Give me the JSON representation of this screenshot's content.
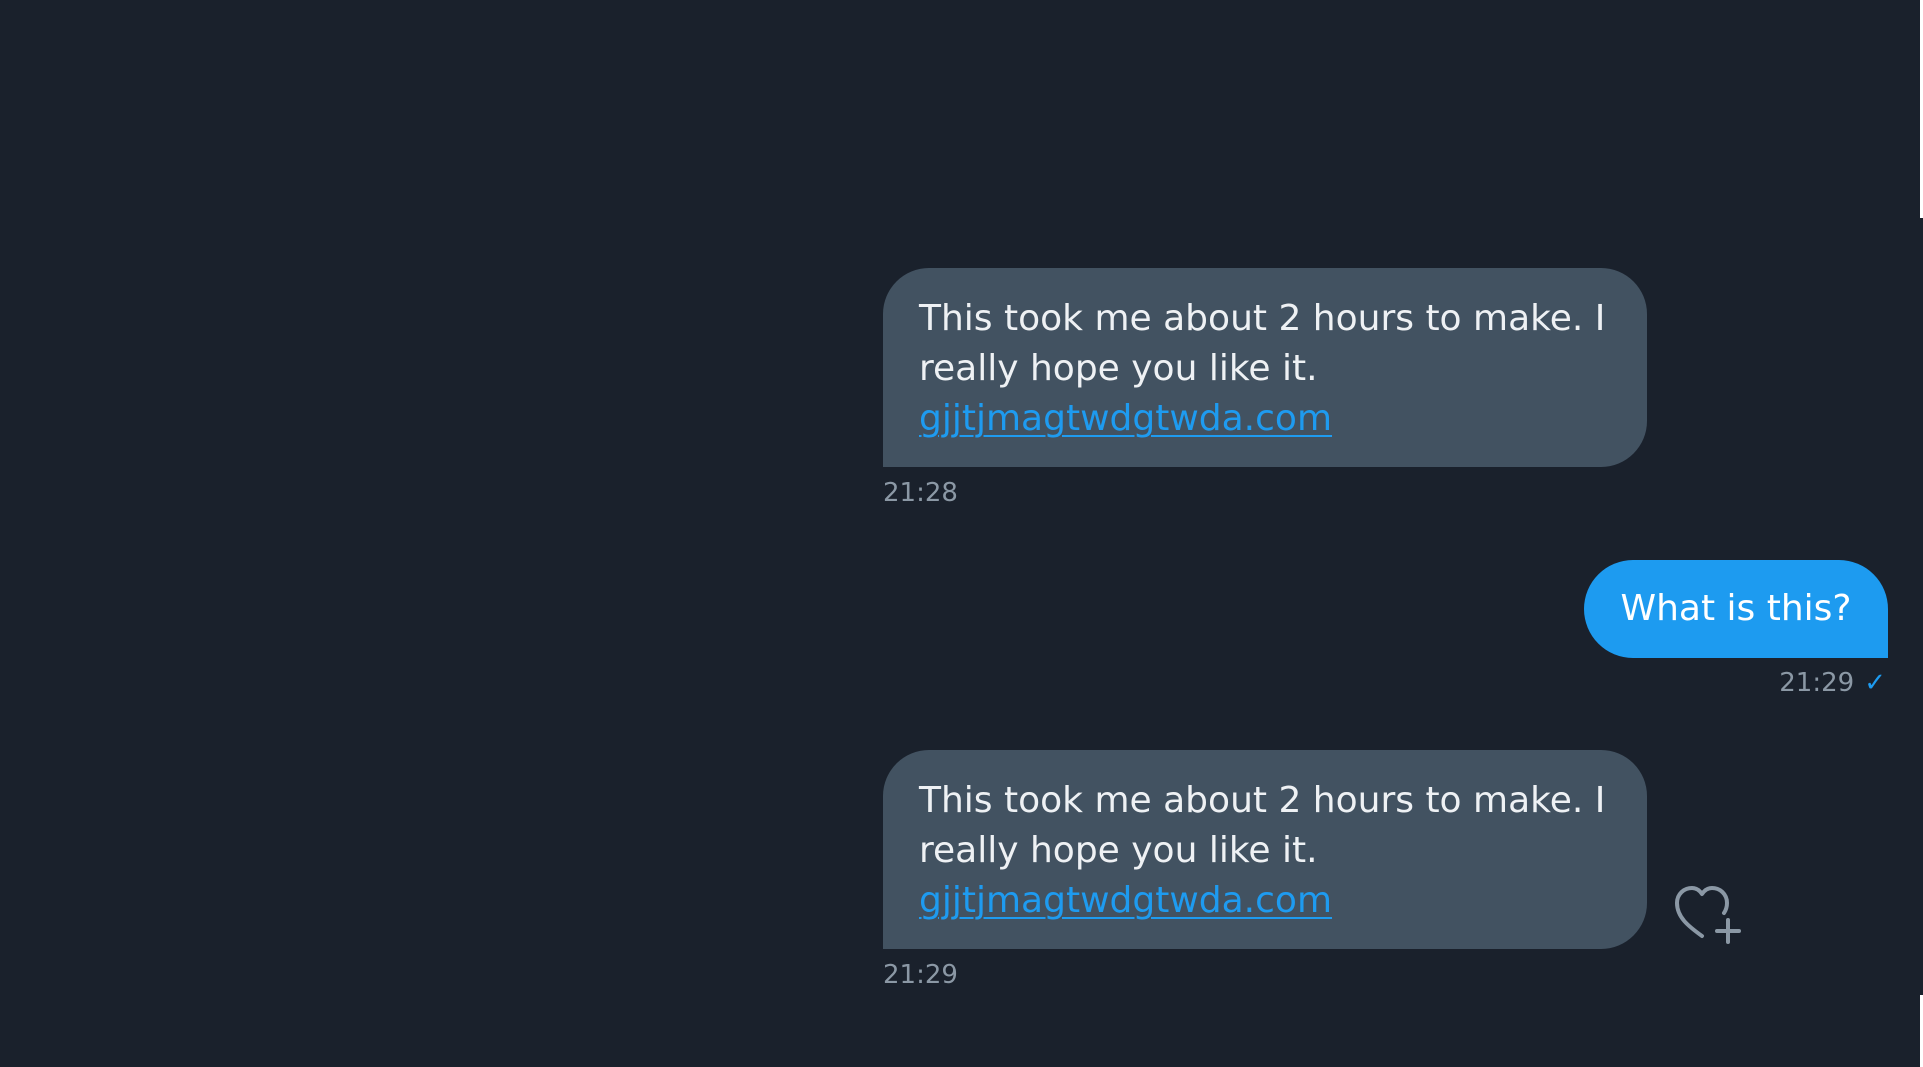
{
  "colors": {
    "background": "#1a212c",
    "incoming_bubble": "#425261",
    "outgoing_bubble": "#1d9bf0",
    "link": "#1e9bf0",
    "timestamp": "#8b98a5"
  },
  "messages": [
    {
      "direction": "incoming",
      "text": "This took me about 2 hours to make. I really hope you like it.",
      "link": "gjjtjmagtwdgtwda.com",
      "time": "21:28"
    },
    {
      "direction": "outgoing",
      "text": "What is this?",
      "time": "21:29",
      "status_icon": "checkmark-icon"
    },
    {
      "direction": "incoming",
      "text": "This took me about 2 hours to make. I really hope you like it.",
      "link": "gjjtjmagtwdgtwda.com",
      "time": "21:29",
      "reaction_icon": "add-reaction-heart-icon"
    }
  ]
}
